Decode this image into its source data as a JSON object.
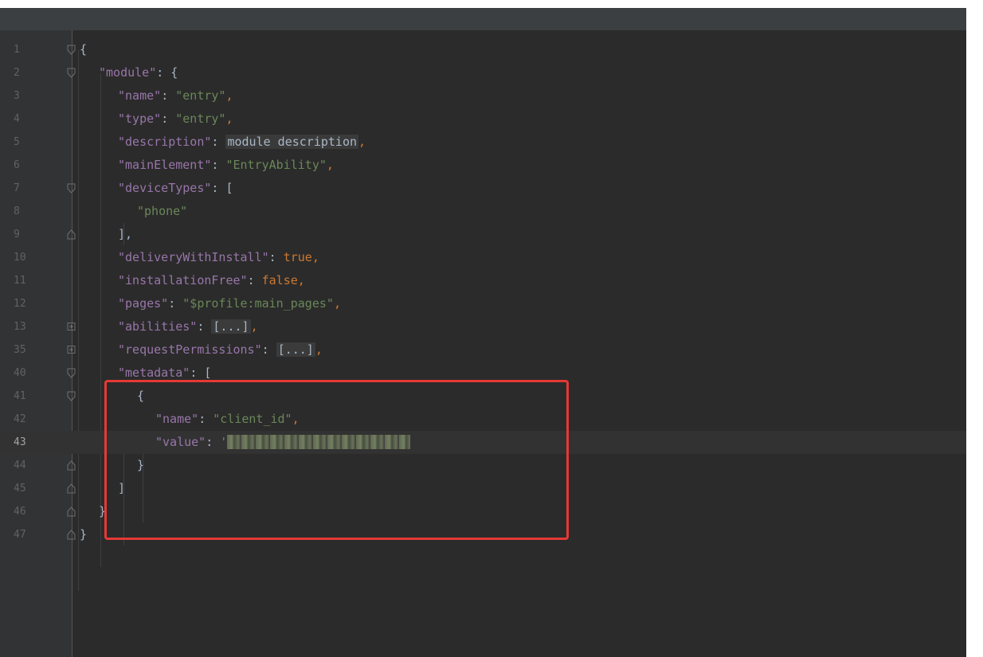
{
  "line_numbers": [
    "1",
    "2",
    "3",
    "4",
    "5",
    "6",
    "7",
    "8",
    "9",
    "10",
    "11",
    "12",
    "13",
    "35",
    "40",
    "41",
    "42",
    "43",
    "44",
    "45",
    "46",
    "47"
  ],
  "code": {
    "l1_open": "{",
    "module_key": "\"module\"",
    "colon_brace": ": {",
    "name_key": "\"name\"",
    "name_val": "\"entry\"",
    "type_key": "\"type\"",
    "type_val": "\"entry\"",
    "description_key": "\"description\"",
    "description_val": "module description",
    "mainElement_key": "\"mainElement\"",
    "mainElement_val": "\"EntryAbility\"",
    "deviceTypes_key": "\"deviceTypes\"",
    "open_bracket": ": [",
    "phone_val": "\"phone\"",
    "close_bracket_comma": "],",
    "deliveryWithInstall_key": "\"deliveryWithInstall\"",
    "true_val": "true",
    "installationFree_key": "\"installationFree\"",
    "false_val": "false",
    "pages_key": "\"pages\"",
    "pages_val": "\"$profile:main_pages\"",
    "abilities_key": "\"abilities\"",
    "requestPermissions_key": "\"requestPermissions\"",
    "folded_placeholder": "[...]",
    "metadata_key": "\"metadata\"",
    "open_brace": "{",
    "client_name_key": "\"name\"",
    "client_name_val": "\"client_id\"",
    "value_key": "\"value\"",
    "value_quote": "'",
    "close_brace": "}",
    "close_bracket": "]",
    "close_module": "}",
    "close_root": "}",
    "colon": ": ",
    "comma": ","
  },
  "colors": {
    "background": "#2b2b2b",
    "key": "#9876aa",
    "string": "#6a8759",
    "keyword": "#cc7832",
    "highlight_box": "#e53935"
  }
}
